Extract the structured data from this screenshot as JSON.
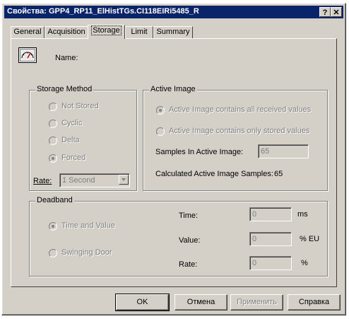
{
  "window": {
    "title": "Свойства: GPP4_RP11_ElHistTGs.CI118EIRi5485_R"
  },
  "titlebar_buttons": {
    "help": "?",
    "close": "✕"
  },
  "tabs": [
    {
      "label": "General"
    },
    {
      "label": "Acquisition"
    },
    {
      "label": "Storage"
    },
    {
      "label": "Limit"
    },
    {
      "label": "Summary"
    }
  ],
  "name_label": "Name:",
  "storage_method": {
    "legend": "Storage Method",
    "options": [
      {
        "label": "Not Stored",
        "checked": false
      },
      {
        "label": "Cyclic",
        "checked": false
      },
      {
        "label": "Delta",
        "checked": false
      },
      {
        "label": "Forced",
        "checked": true
      }
    ],
    "rate_label": "Rate:",
    "rate_value": "1 Second"
  },
  "active_image": {
    "legend": "Active Image",
    "option_all": "Active Image contains all received values",
    "option_stored": "Active Image contains only stored values",
    "samples_label": "Samples In Active Image:",
    "samples_value": "65",
    "calculated_label": "Calculated Active Image Samples:",
    "calculated_value": "65"
  },
  "deadband": {
    "legend": "Deadband",
    "option_time_value": "Time and Value",
    "option_swinging": "Swinging Door",
    "time_label": "Time:",
    "time_value": "0",
    "time_unit": "ms",
    "value_label": "Value:",
    "value_value": "0",
    "value_unit": "% EU",
    "rate_label": "Rate:",
    "rate_value": "0",
    "rate_unit": "%"
  },
  "buttons": {
    "ok": "OK",
    "cancel": "Отмена",
    "apply": "Применить",
    "help": "Справка"
  }
}
